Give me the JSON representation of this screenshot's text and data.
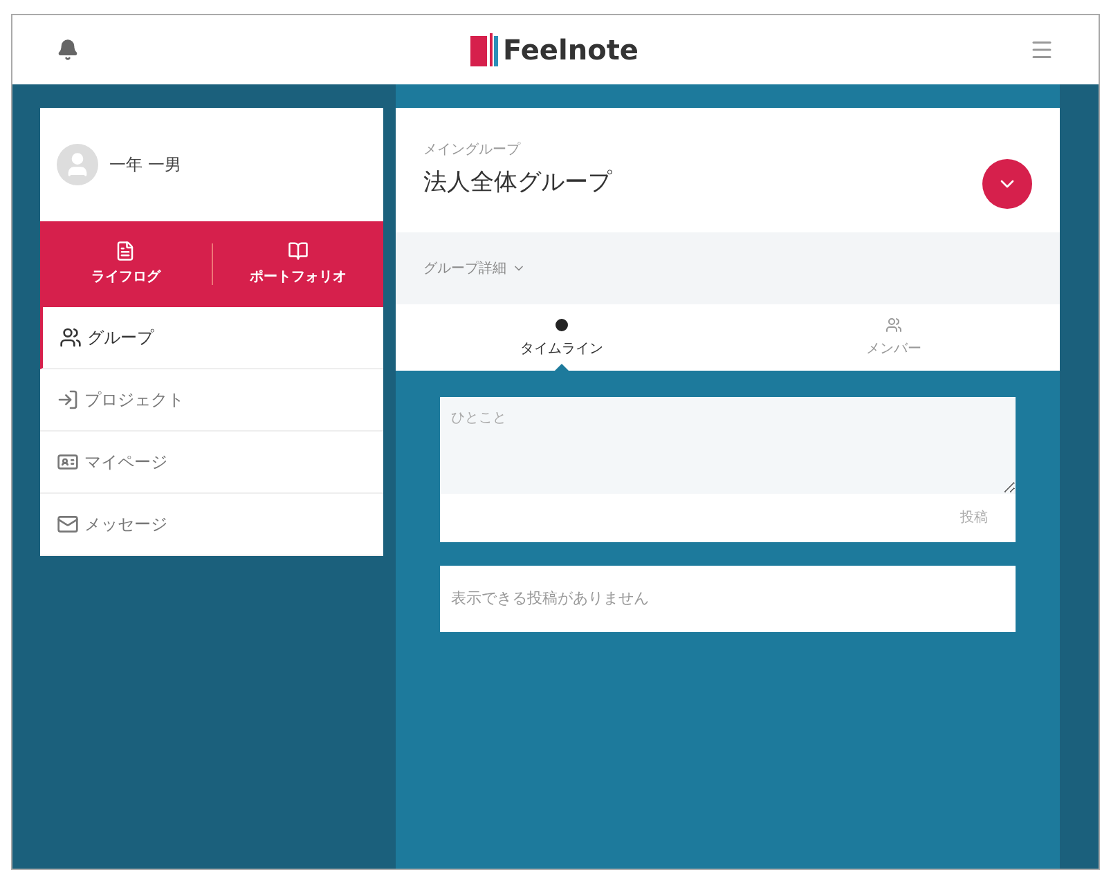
{
  "header": {
    "logo_text": "Feelnote"
  },
  "profile": {
    "name": "一年 一男"
  },
  "quick_links": [
    {
      "label": "ライフログ",
      "kind": "lifelog"
    },
    {
      "label": "ポートフォリオ",
      "kind": "portfolio"
    }
  ],
  "menu": [
    {
      "label": "グループ",
      "kind": "group",
      "selected": true
    },
    {
      "label": "プロジェクト",
      "kind": "project",
      "selected": false
    },
    {
      "label": "マイページ",
      "kind": "mypage",
      "selected": false
    },
    {
      "label": "メッセージ",
      "kind": "message",
      "selected": false
    }
  ],
  "group": {
    "caption": "メイングループ",
    "name": "法人全体グループ",
    "details_toggle": "グループ詳細"
  },
  "tabs": [
    {
      "label": "タイムライン",
      "kind": "timeline",
      "selected": true
    },
    {
      "label": "メンバー",
      "kind": "members",
      "selected": false
    }
  ],
  "composer": {
    "placeholder": "ひとこと",
    "submit": "投稿"
  },
  "empty_message": "表示できる投稿がありません"
}
